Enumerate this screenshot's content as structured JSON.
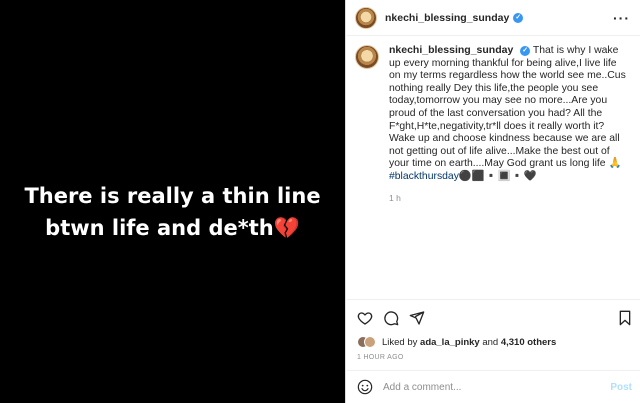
{
  "media": {
    "caption": "There is really a thin line\nbtwn life and de*th💔"
  },
  "post": {
    "username": "nkechi_blessing_sunday",
    "verified_mark": "✓",
    "more_label": "···",
    "caption": "That is why I wake up every morning thankful for being alive,I live life on my terms regardless how the world see me..Cus nothing really Dey this life,the people you see today,tomorrow you may see no more...Are you proud of the last conversation you had? All the F*ght,H*te,negativity,tr*ll does it really worth it? Wake up and choose kindness because we are all not getting out of life alive...Make the best out of your time on earth....May God grant us long life 🙏",
    "hashtag": "#blackthursday",
    "emoji_tail": "⚫⬛▪️🔳▪️🖤",
    "caption_time": "1 h",
    "liked_by_prefix": "Liked by",
    "liked_by_user": "ada_la_pinky",
    "liked_by_and": "and",
    "liked_by_others": "4,310 others",
    "time_ago": "1 HOUR AGO",
    "comment_placeholder": "Add a comment...",
    "post_button": "Post"
  },
  "icons": [
    "heart-icon",
    "comment-icon",
    "share-icon",
    "bookmark-icon",
    "emoji-icon",
    "more-icon",
    "verified-icon"
  ]
}
